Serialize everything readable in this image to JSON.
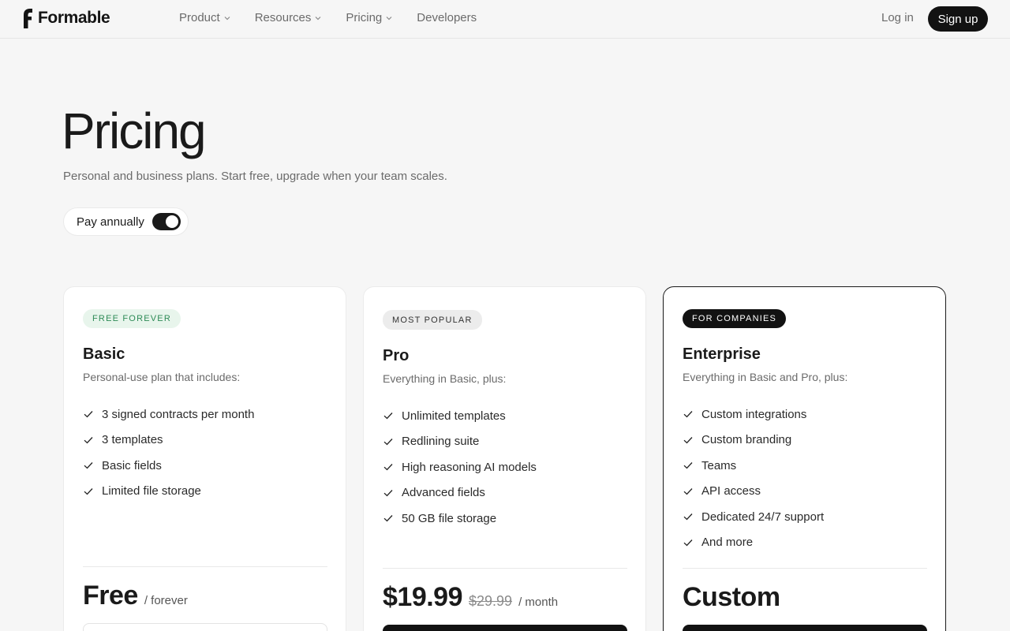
{
  "brand": {
    "name": "Formable"
  },
  "nav": {
    "items": [
      {
        "label": "Product",
        "has_menu": true
      },
      {
        "label": "Resources",
        "has_menu": true
      },
      {
        "label": "Pricing",
        "has_menu": true
      },
      {
        "label": "Developers",
        "has_menu": false
      }
    ],
    "login": "Log in",
    "signup": "Sign up"
  },
  "hero": {
    "title": "Pricing",
    "subtitle": "Personal and business plans. Start free, upgrade when your team scales.",
    "billing_toggle": {
      "label": "Pay annually",
      "on": true
    }
  },
  "plans": [
    {
      "badge": "FREE FOREVER",
      "name": "Basic",
      "description": "Personal-use plan that includes:",
      "features": [
        "3 signed contracts per month",
        "3 templates",
        "Basic fields",
        "Limited file storage"
      ],
      "price": "Free",
      "price_unit": "/ forever"
    },
    {
      "badge": "MOST POPULAR",
      "name": "Pro",
      "description": "Everything in Basic, plus:",
      "features": [
        "Unlimited templates",
        "Redlining suite",
        "High reasoning AI models",
        "Advanced fields",
        "50 GB file storage"
      ],
      "price": "$19.99",
      "price_old": "$29.99",
      "price_unit": "/ month"
    },
    {
      "badge": "FOR COMPANIES",
      "name": "Enterprise",
      "description": "Everything in Basic and Pro, plus:",
      "features": [
        "Custom integrations",
        "Custom branding",
        "Teams",
        "API access",
        "Dedicated 24/7 support",
        "And more"
      ],
      "price": "Custom"
    }
  ],
  "colors": {
    "accent": "#121212",
    "badge_green_bg": "#e8f5ec",
    "badge_green_text": "#2e8b57",
    "page_bg": "#f6f6f6"
  },
  "icons": {
    "feature": "check-icon",
    "menu": "chevron-down-icon"
  }
}
